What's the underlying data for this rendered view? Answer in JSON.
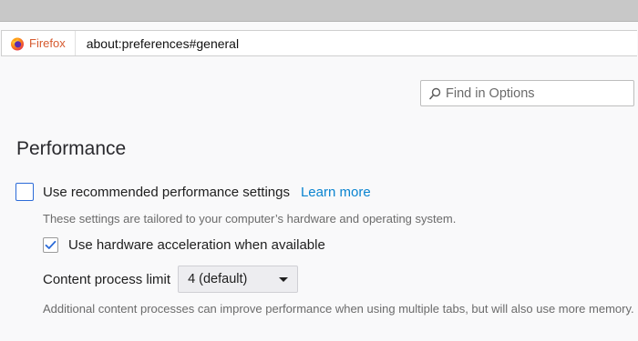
{
  "tabstrip": {},
  "urlbar": {
    "identity_label": "Firefox",
    "url": "about:preferences#general"
  },
  "search": {
    "placeholder": "Find in Options"
  },
  "performance": {
    "heading": "Performance",
    "recommended": {
      "label": "Use recommended performance settings",
      "checked": false,
      "link": "Learn more",
      "description": "These settings are tailored to your computer’s hardware and operating system."
    },
    "hardware_accel": {
      "label": "Use hardware acceleration when available",
      "checked": true
    },
    "process_limit": {
      "label": "Content process limit",
      "selected": "4 (default)",
      "description": "Additional content processes can improve performance when using multiple tabs, but will also use more memory."
    }
  },
  "colors": {
    "accent": "#0a84d0",
    "checkbox_border": "#2c6bd8",
    "identity_text": "#d65a2f"
  }
}
